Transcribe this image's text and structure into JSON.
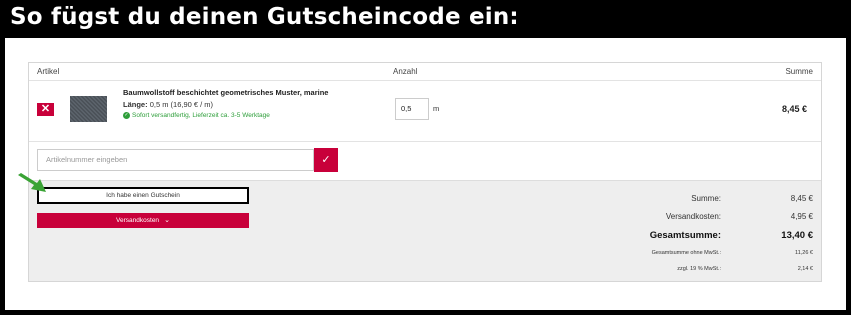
{
  "banner": {
    "title": "So fügst du deinen Gutscheincode ein:"
  },
  "table": {
    "col_article": "Artikel",
    "col_quantity": "Anzahl",
    "col_sum": "Summe"
  },
  "item": {
    "remove_icon": "close-icon",
    "name": "Baumwollstoff beschichtet geometrisches Muster, marine",
    "length_label": "Länge:",
    "length_value": "0,5 m (16,90 € / m)",
    "availability": "Sofort versandfertig, Lieferzeit ca. 3-5 Werktage",
    "quantity": "0,5",
    "unit": "m",
    "price": "8,45 €"
  },
  "article_input": {
    "placeholder": "Artikelnummer eingeben"
  },
  "coupon_button": "Ich habe einen Gutschein",
  "shipping_button": "Versandkosten",
  "totals": {
    "sum_label": "Summe:",
    "sum_value": "8,45 €",
    "shipping_label": "Versandkosten:",
    "shipping_value": "4,95 €",
    "total_label": "Gesamtsumme:",
    "total_value": "13,40 €",
    "net_label": "Gesamtsumme ohne MwSt.:",
    "net_value": "11,26 €",
    "vat_label": "zzgl. 19 % MwSt.:",
    "vat_value": "2,14 €"
  },
  "colors": {
    "accent": "#c8003a",
    "availability": "#2e9e3a",
    "arrow": "#3aa335"
  }
}
